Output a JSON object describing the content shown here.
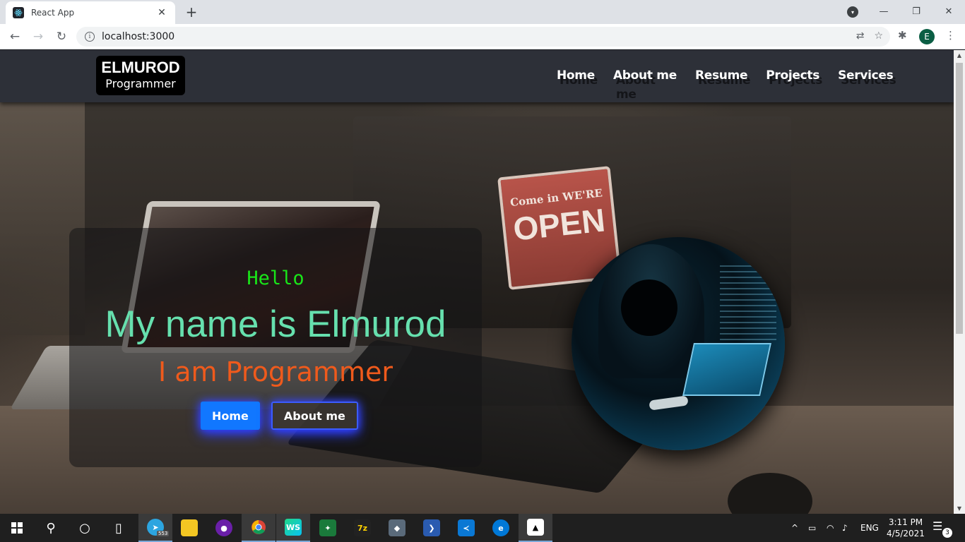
{
  "browser": {
    "tab_title": "React App",
    "url": "localhost:3000",
    "profile_initial": "E"
  },
  "site": {
    "logo_line1": "ELMUROD",
    "logo_line2": "Programmer",
    "nav": [
      {
        "label": "Home"
      },
      {
        "label": "About me"
      },
      {
        "label": "Resume"
      },
      {
        "label": "Projects"
      },
      {
        "label": "Services"
      }
    ],
    "hero": {
      "greeting": "Hello",
      "headline": "My name is Elmurod",
      "role": "I am Programmer",
      "primary_button": "Home",
      "secondary_button": "About me"
    },
    "sign": {
      "small": "Come in WE'RE",
      "big": "OPEN"
    }
  },
  "taskbar": {
    "apps": [
      {
        "icon": "windows-start-icon"
      },
      {
        "icon": "search-icon"
      },
      {
        "icon": "cortana-icon"
      },
      {
        "icon": "task-view-icon"
      },
      {
        "icon": "telegram-icon",
        "badge": "553"
      },
      {
        "icon": "file-explorer-icon"
      },
      {
        "icon": "media-app-icon"
      },
      {
        "icon": "chrome-icon"
      },
      {
        "icon": "webstorm-icon",
        "label": "WS"
      },
      {
        "icon": "app-icon-1"
      },
      {
        "icon": "7zip-icon",
        "label": "7z"
      },
      {
        "icon": "app-icon-2"
      },
      {
        "icon": "powershell-icon"
      },
      {
        "icon": "vscode-icon"
      },
      {
        "icon": "edge-icon"
      },
      {
        "icon": "photos-icon"
      }
    ],
    "language": "ENG",
    "time": "3:11 PM",
    "date": "4/5/2021",
    "notification_count": "3"
  },
  "colors": {
    "greeting": "#19e619",
    "headline": "#66e0ae",
    "role": "#ef5a1c",
    "primary_button": "#1177ff",
    "navbar": "#2d3038"
  }
}
